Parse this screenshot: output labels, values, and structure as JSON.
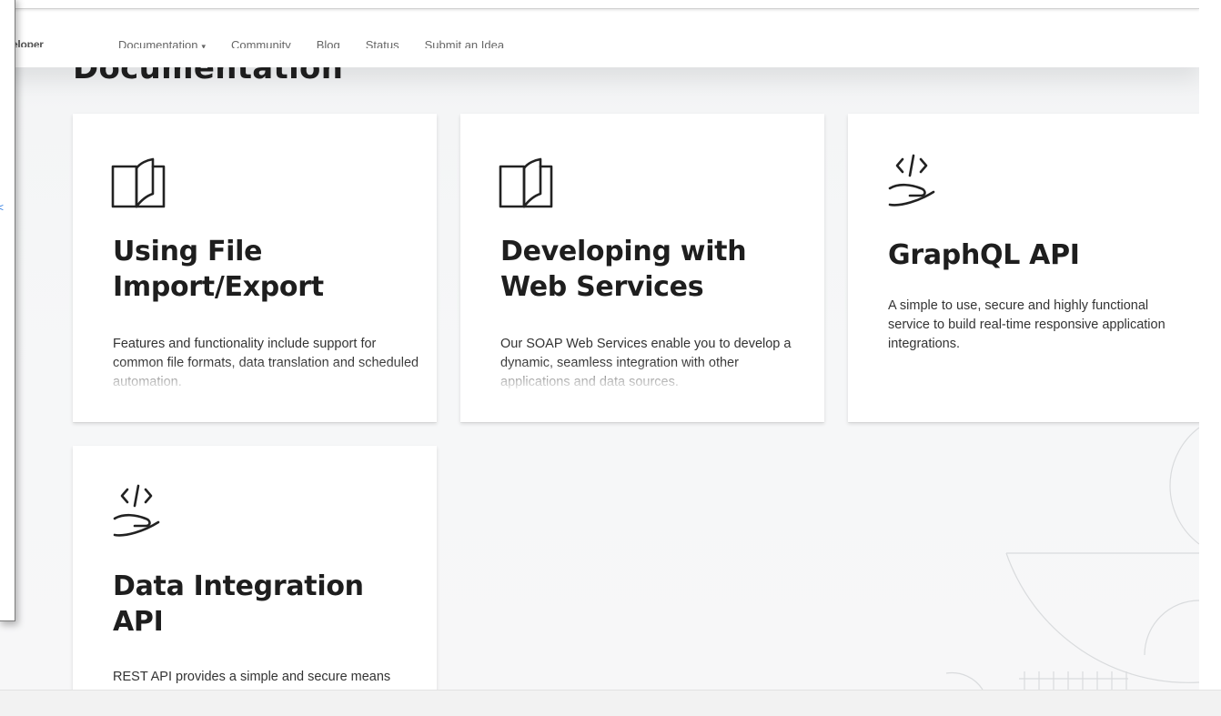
{
  "nav": {
    "brand": "eveloper",
    "links": [
      {
        "label": "Documentation",
        "caret": "▾"
      },
      {
        "label": "Community"
      },
      {
        "label": "Blog"
      },
      {
        "label": "Status"
      },
      {
        "label": "Submit an Idea"
      }
    ]
  },
  "page": {
    "heading": "Documentation"
  },
  "cards": [
    {
      "icon": "open-book-icon",
      "title_lines": [
        "Using File",
        "Import/Export"
      ],
      "description": "Features and functionality include support for common file formats, data translation and scheduled automation."
    },
    {
      "icon": "open-book-icon",
      "title_lines": [
        "Developing with",
        "Web Services"
      ],
      "description": "Our SOAP Web Services enable you to develop a dynamic, seamless integration with other applications and data sources."
    },
    {
      "icon": "code-hand-icon",
      "title_lines": [
        "GraphQL API"
      ],
      "description": "A simple to use, secure and highly functional service to build real-time responsive application integrations."
    },
    {
      "icon": "code-hand-icon",
      "title_lines": [
        "Data Integration",
        "API"
      ],
      "description": "REST API provides a simple and secure means"
    }
  ],
  "overlay": {
    "glyph": "<"
  },
  "colors": {
    "background": "#f4f5f6",
    "card": "#ffffff",
    "text": "#1f1f1f",
    "link_glyph": "#2a7ae2"
  }
}
